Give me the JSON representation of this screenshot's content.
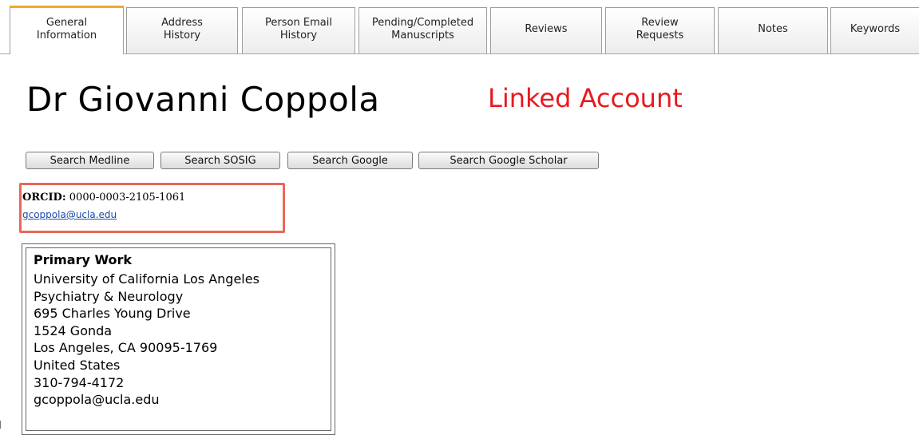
{
  "tabs": [
    {
      "label": "General\nInformation",
      "active": true
    },
    {
      "label": "Address\nHistory",
      "active": false
    },
    {
      "label": "Person Email\nHistory",
      "active": false
    },
    {
      "label": "Pending/Completed\nManuscripts",
      "active": false
    },
    {
      "label": "Reviews",
      "active": false
    },
    {
      "label": "Review\nRequests",
      "active": false
    },
    {
      "label": "Notes",
      "active": false
    },
    {
      "label": "Keywords",
      "active": false
    }
  ],
  "person": {
    "name": "Dr Giovanni Coppola",
    "linked_label": "Linked Account"
  },
  "search_buttons": [
    "Search Medline",
    "Search SOSIG",
    "Search Google",
    "Search Google Scholar"
  ],
  "orcid": {
    "label": "ORCID:",
    "value": "0000-0003-2105-1061",
    "email": "gcoppola@ucla.edu"
  },
  "primary_work": {
    "title": "Primary Work",
    "lines": [
      "University of California Los Angeles",
      "Psychiatry & Neurology",
      "695 Charles Young Drive",
      "1524 Gonda",
      "Los Angeles, CA 90095-1769",
      "United States",
      "310-794-4172",
      "gcoppola@ucla.edu"
    ]
  },
  "colors": {
    "linked": "#e8191f",
    "highlight_border": "#e8685a",
    "active_tab_accent": "#f2a82e",
    "link": "#1a4aa8"
  }
}
